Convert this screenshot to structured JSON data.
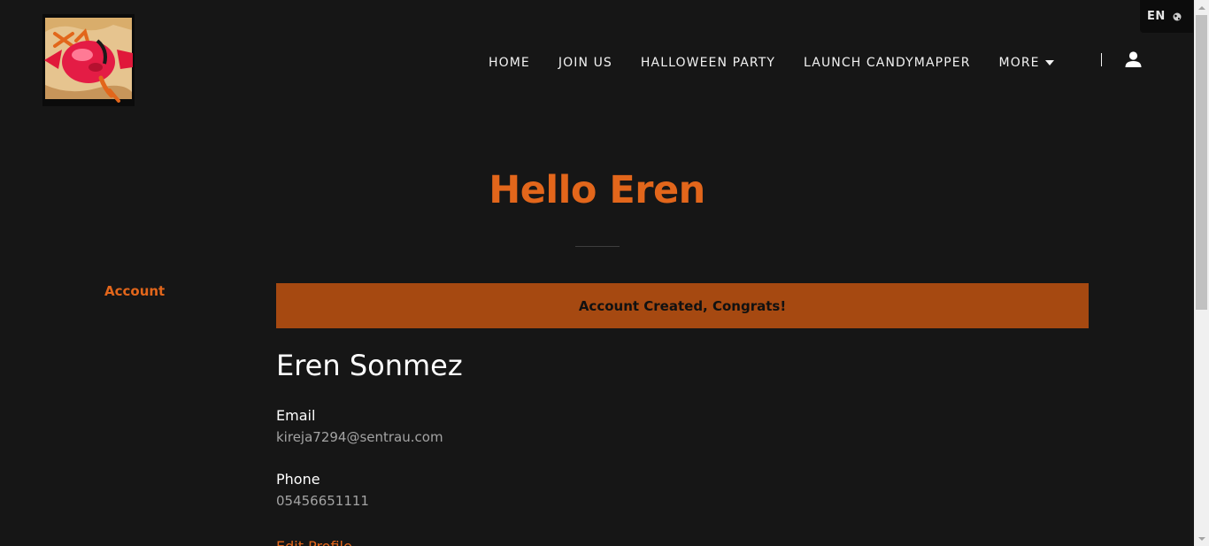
{
  "brand": {
    "logo_alt": "CandyMapper logo",
    "accent_color": "#e2661b",
    "banner_color": "#a64911",
    "background_color": "#161616"
  },
  "language": {
    "label": "EN",
    "icon": "globe-icon"
  },
  "nav": {
    "items": [
      {
        "label": "HOME"
      },
      {
        "label": "JOIN US"
      },
      {
        "label": "HALLOWEEN PARTY"
      },
      {
        "label": "LAUNCH CANDYMAPPER"
      }
    ],
    "more_label": "MORE",
    "more_icon": "caret-down-icon",
    "account_icon": "user-icon"
  },
  "page": {
    "title": "Hello Eren"
  },
  "sidebar": {
    "account_label": "Account"
  },
  "banner": {
    "message": "Account Created, Congrats!"
  },
  "profile": {
    "name": "Eren Sonmez",
    "email_label": "Email",
    "email_value": "kireja7294@sentrau.com",
    "phone_label": "Phone",
    "phone_value": "05456651111",
    "edit_label": "Edit Profile"
  }
}
